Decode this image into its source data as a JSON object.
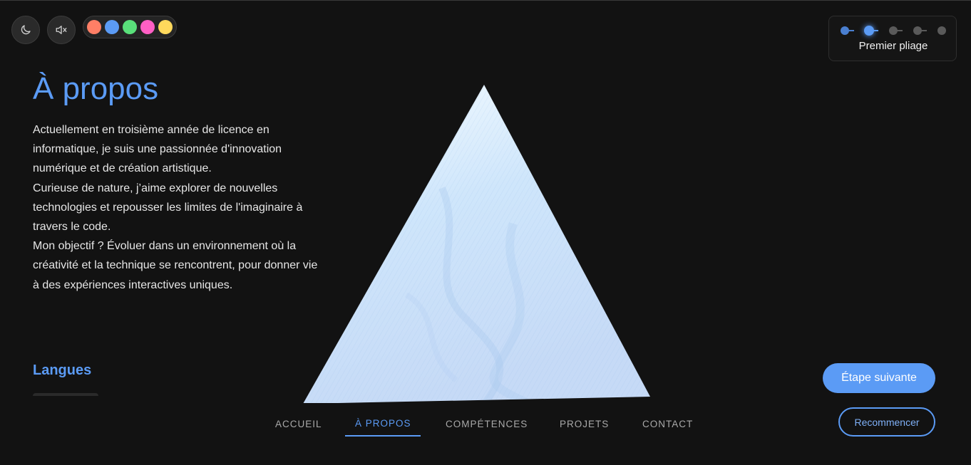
{
  "controls": {
    "theme_icon": "moon-icon",
    "sound_icon": "speaker-muted-icon",
    "palette": [
      {
        "name": "coral",
        "color": "#ff7f66"
      },
      {
        "name": "blue",
        "color": "#5b9bf5"
      },
      {
        "name": "green",
        "color": "#59e07a"
      },
      {
        "name": "pink",
        "color": "#ff5fc4"
      },
      {
        "name": "yellow",
        "color": "#ffd95c"
      }
    ]
  },
  "steps": {
    "total": 5,
    "current": 2,
    "label": "Premier pliage"
  },
  "about": {
    "title": "À propos",
    "paragraphs": [
      "Actuellement en troisième année de licence en informatique, je suis une passionnée d'innovation numérique et de création artistique.",
      "Curieuse de nature, j’aime explorer de nouvelles technologies et repousser les limites de l'imaginaire à travers le code.",
      "Mon objectif ? Évoluer dans un environnement où la créativité et la technique se rencontrent, pour donner vie à des expériences interactives uniques."
    ],
    "languages_title": "Langues"
  },
  "nav": {
    "items": [
      "ACCUEIL",
      "À PROPOS",
      "COMPÉTENCES",
      "PROJETS",
      "CONTACT"
    ],
    "active_index": 1
  },
  "buttons": {
    "next": "Étape suivante",
    "restart": "Recommencer"
  },
  "colors": {
    "accent": "#5b9bf5",
    "background": "#121212"
  }
}
